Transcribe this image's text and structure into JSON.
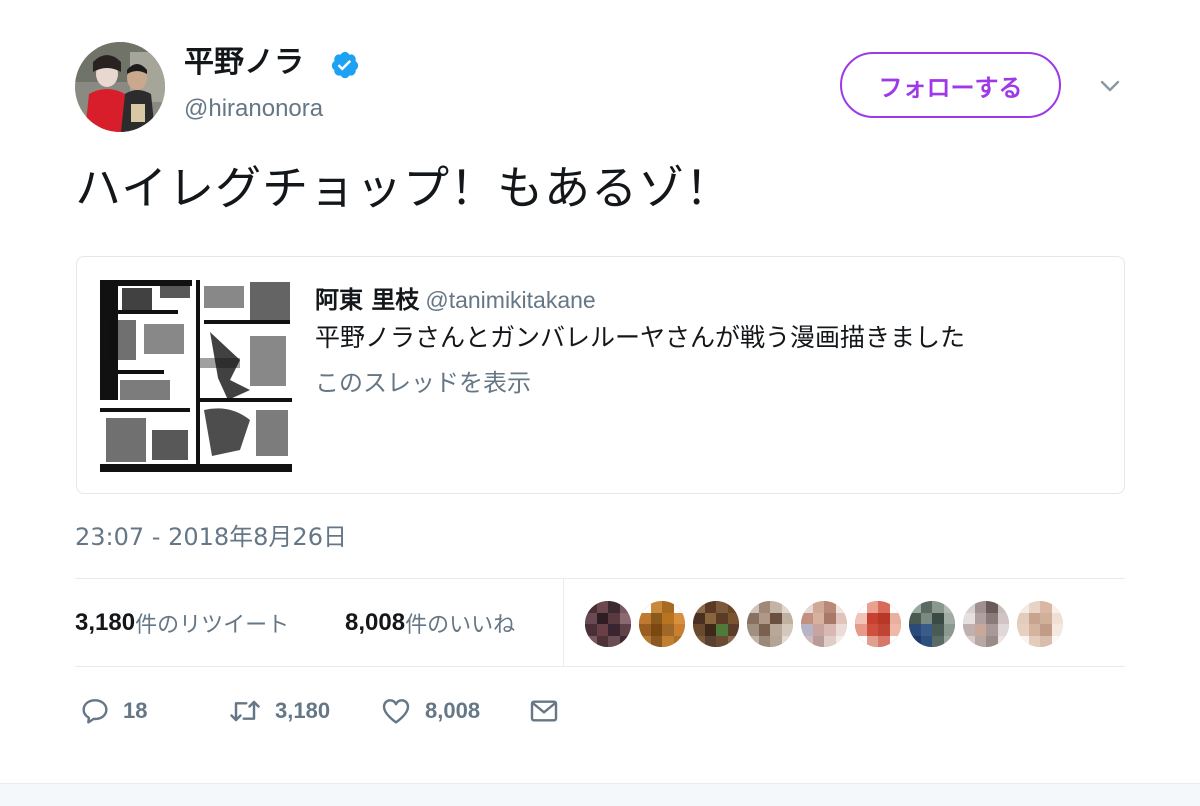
{
  "tweet": {
    "author_name": "平野ノラ",
    "author_handle": "@hiranonora",
    "follow_label": "フォローする",
    "text": "ハイレグチョップ！もあるゾ！",
    "timestamp": "23:07 - 2018年8月26日"
  },
  "quoted": {
    "author_name": "阿東 里枝",
    "author_handle": "@tanimikitakane",
    "text": "平野ノラさんとガンバレルーヤさんが戦う漫画描きました",
    "thread_link": "このスレッドを表示"
  },
  "stats": {
    "retweets_count": "3,180",
    "retweets_label": "件のリツイート",
    "likes_count": "8,008",
    "likes_label": "件のいいね"
  },
  "actions": {
    "reply_count": "18",
    "retweet_count": "3,180",
    "like_count": "8,008"
  },
  "colors": {
    "accent": "#9f38e8",
    "verified": "#1da1f2",
    "muted": "#657786",
    "border": "#e6ecf0"
  },
  "icons": [
    "verified-badge-icon",
    "chevron-down-icon",
    "reply-icon",
    "retweet-icon",
    "heart-icon",
    "envelope-icon"
  ]
}
